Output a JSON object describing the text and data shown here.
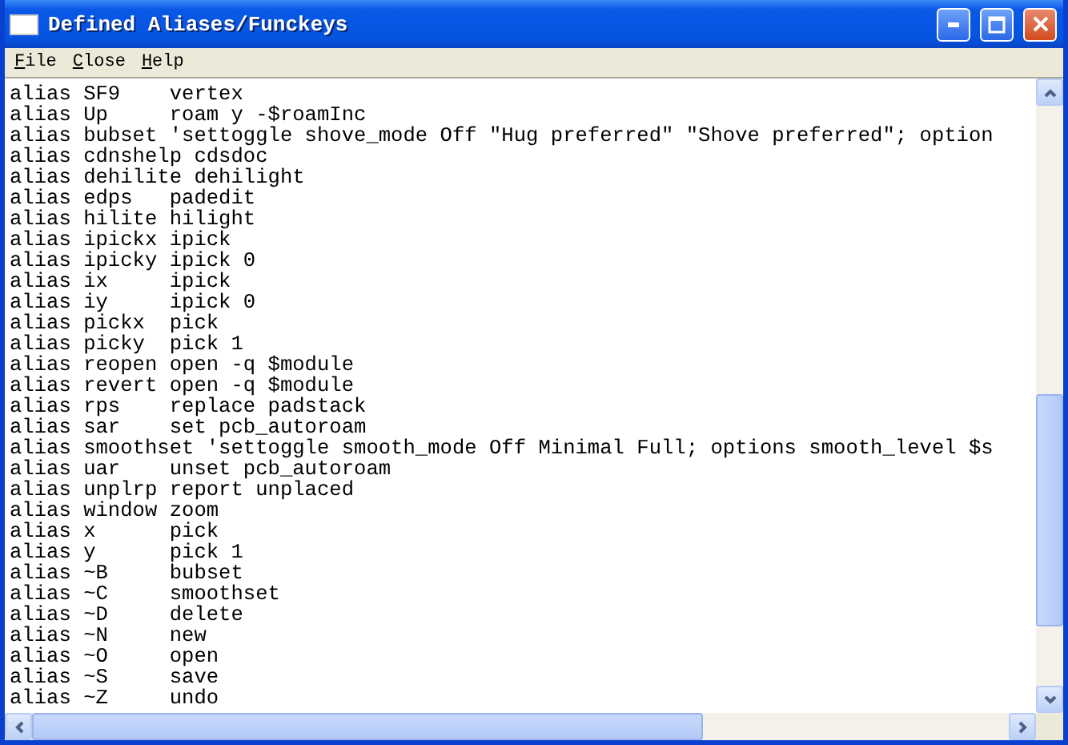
{
  "window": {
    "title": "Defined Aliases/Funckeys"
  },
  "menu": [
    {
      "label": "File"
    },
    {
      "label": "Close"
    },
    {
      "label": "Help"
    }
  ],
  "lines": [
    "alias SF9    vertex",
    "alias Up     roam y -$roamInc",
    "alias bubset 'settoggle shove_mode Off \"Hug preferred\" \"Shove preferred\"; option",
    "alias cdnshelp cdsdoc",
    "alias dehilite dehilight",
    "alias edps   padedit",
    "alias hilite hilight",
    "alias ipickx ipick",
    "alias ipicky ipick 0",
    "alias ix     ipick",
    "alias iy     ipick 0",
    "alias pickx  pick",
    "alias picky  pick 1",
    "alias reopen open -q $module",
    "alias revert open -q $module",
    "alias rps    replace padstack",
    "alias sar    set pcb_autoroam",
    "alias smoothset 'settoggle smooth_mode Off Minimal Full; options smooth_level $s",
    "alias uar    unset pcb_autoroam",
    "alias unplrp report unplaced",
    "alias window zoom",
    "alias x      pick",
    "alias y      pick 1",
    "alias ~B     bubset",
    "alias ~C     smoothset",
    "alias ~D     delete",
    "alias ~N     new",
    "alias ~O     open",
    "alias ~S     save",
    "alias ~Z     undo"
  ]
}
